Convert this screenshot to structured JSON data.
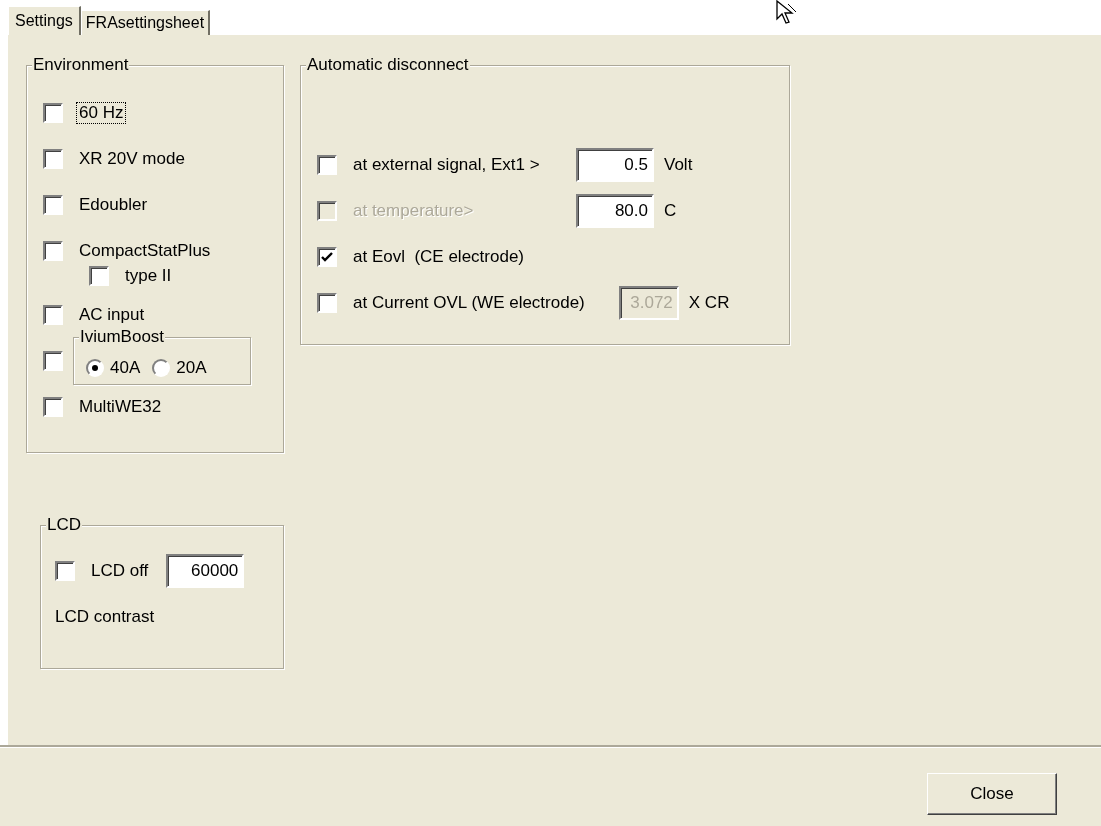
{
  "tabs": [
    {
      "label": "Settings",
      "selected": true
    },
    {
      "label": "FRAsettingsheet",
      "selected": false
    }
  ],
  "environment": {
    "title": "Environment",
    "options": [
      {
        "kind": "checkbox",
        "label": "60 Hz",
        "checked": false,
        "focused": true
      },
      {
        "kind": "checkbox",
        "label": "XR 20V mode",
        "checked": false,
        "focused": false
      },
      {
        "kind": "checkbox",
        "label": "Edoubler",
        "checked": false,
        "focused": false
      },
      {
        "kind": "checkbox",
        "label": "CompactStatPlus",
        "checked": false,
        "focused": false,
        "children": [
          {
            "kind": "checkbox",
            "label": "type II",
            "checked": false,
            "focused": false
          }
        ]
      },
      {
        "kind": "checkbox",
        "label": "AC input",
        "checked": false,
        "focused": false
      },
      {
        "kind": "radio_group",
        "title": "IviumBoost",
        "checked": false,
        "options": [
          {
            "label": "40A",
            "selected": true
          },
          {
            "label": "20A",
            "selected": false
          }
        ]
      },
      {
        "kind": "checkbox",
        "label": "MultiWE32",
        "checked": false,
        "focused": false
      }
    ]
  },
  "lcd": {
    "title": "LCD",
    "off": {
      "label": "LCD off",
      "checked": false
    },
    "value": "60000",
    "contrast_label": "LCD contrast"
  },
  "auto_disconnect": {
    "title": "Automatic disconnect",
    "rows": [
      {
        "label": "at external signal, Ext1 >",
        "checked": false,
        "disabled": false,
        "value": "0.5",
        "value_disabled": false,
        "unit": "Volt"
      },
      {
        "label": "at temperature>",
        "checked": false,
        "disabled": true,
        "value": "80.0",
        "value_disabled": false,
        "unit": "C"
      },
      {
        "label": "at Eovl  (CE electrode)",
        "checked": true,
        "disabled": false
      },
      {
        "label": "at Current OVL (WE electrode)",
        "checked": false,
        "disabled": false,
        "value": "3.072",
        "value_disabled": true,
        "unit": "X CR"
      }
    ]
  },
  "buttons": [
    {
      "label": "Close"
    }
  ]
}
